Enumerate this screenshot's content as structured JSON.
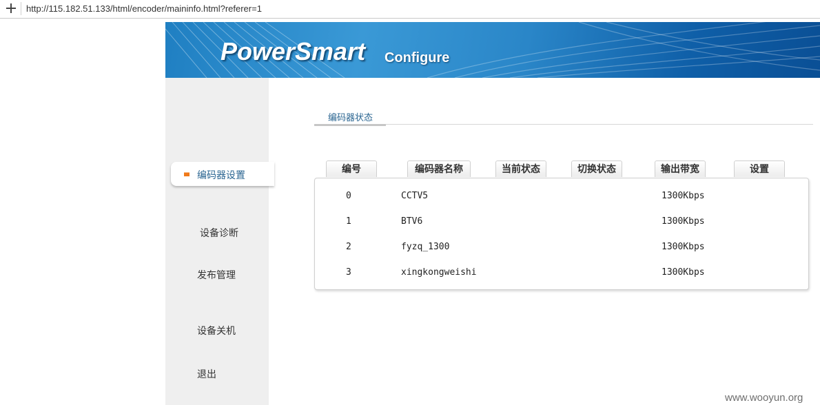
{
  "browser": {
    "url": "http://115.182.51.133/html/encoder/maininfo.html?referer=1"
  },
  "banner": {
    "brand": "PowerSmart",
    "subtitle": "Configure"
  },
  "sidebar": {
    "items": [
      {
        "label": "编码器设置"
      },
      {
        "label": "设备诊断"
      },
      {
        "label": "发布管理"
      },
      {
        "label": "设备关机"
      },
      {
        "label": "退出"
      }
    ]
  },
  "tab": {
    "label": "编码器状态"
  },
  "table": {
    "headers": [
      "编号",
      "编码器名称",
      "当前状态",
      "切换状态",
      "输出带宽",
      "设置"
    ],
    "rows": [
      {
        "id": "0",
        "name": "CCTV5",
        "bandwidth": "1300Kbps"
      },
      {
        "id": "1",
        "name": "BTV6",
        "bandwidth": "1300Kbps"
      },
      {
        "id": "2",
        "name": "fyzq_1300",
        "bandwidth": "1300Kbps"
      },
      {
        "id": "3",
        "name": "xingkongweishi",
        "bandwidth": "1300Kbps"
      }
    ]
  },
  "watermark": "www.wooyun.org",
  "colors": {
    "banner_blue": "#2a86c8",
    "sidebar_bg": "#efefef",
    "active_bullet": "#f07a1a",
    "tab_text": "#2a6591"
  }
}
